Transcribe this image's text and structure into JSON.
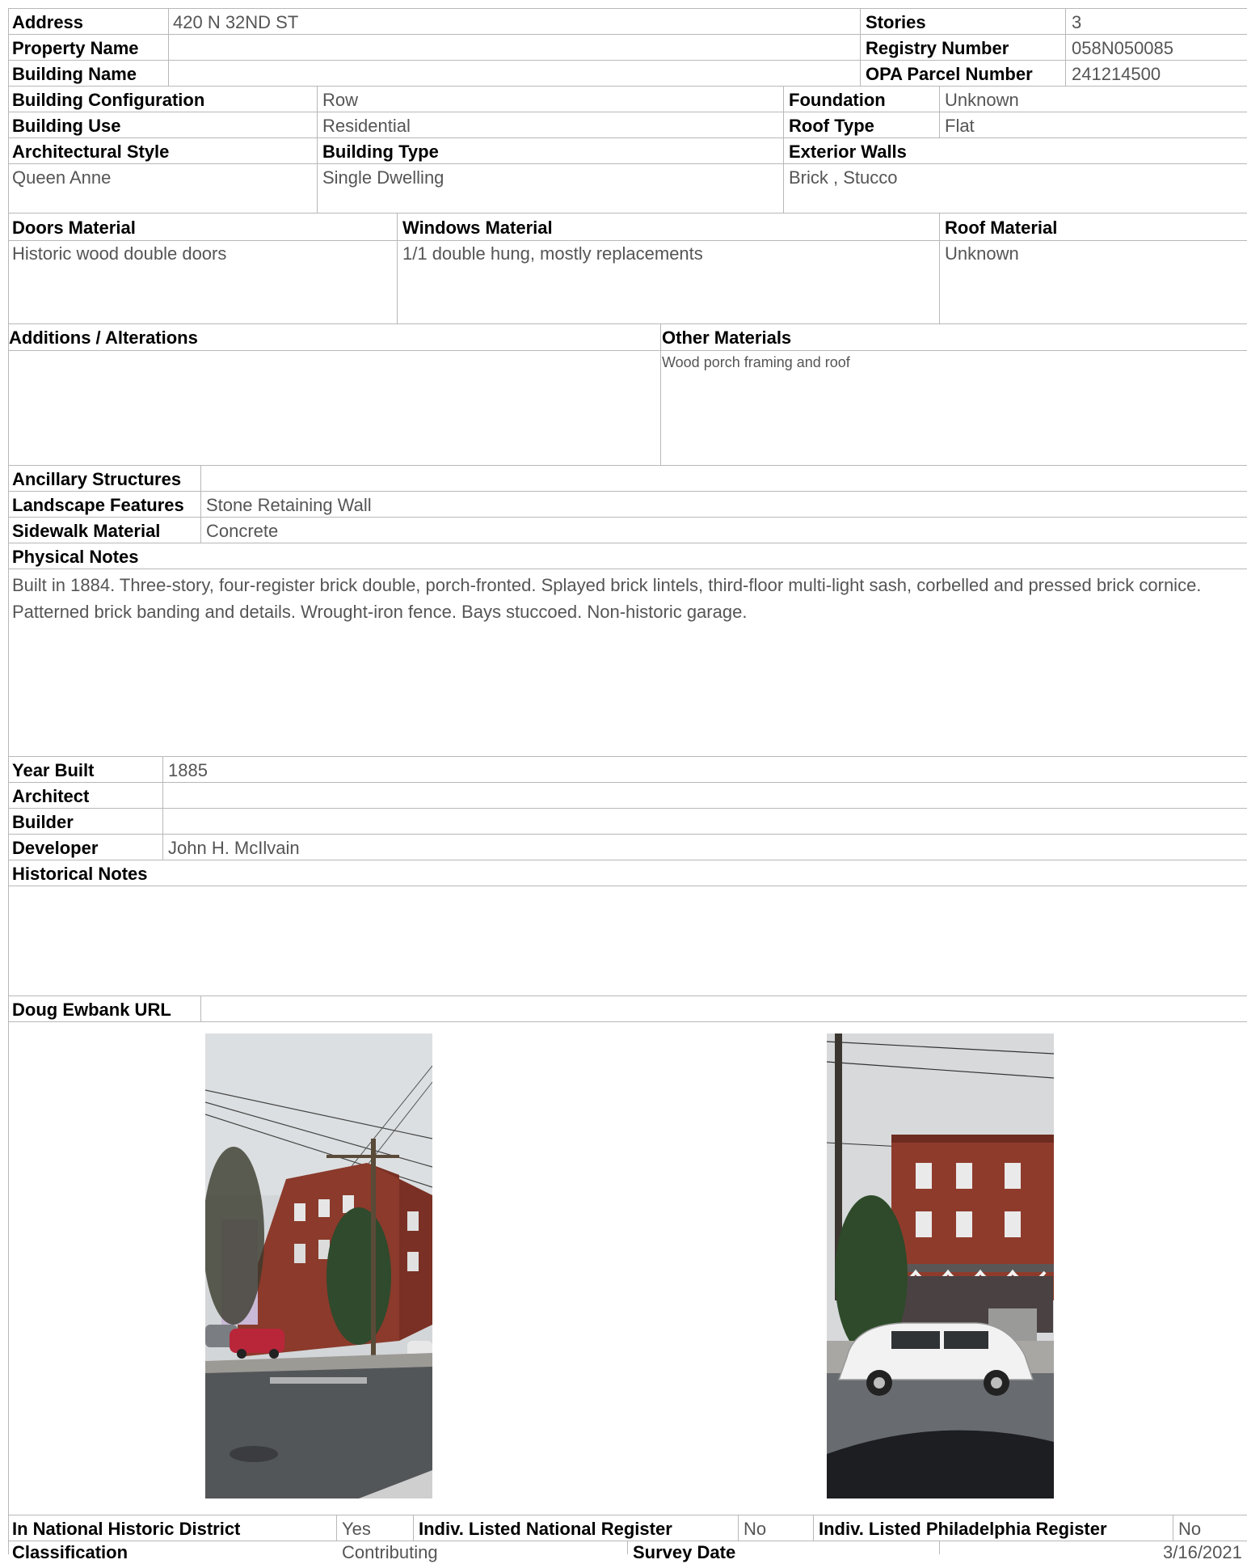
{
  "rows": {
    "address_label": "Address",
    "address": "420 N 32ND ST",
    "stories_label": "Stories",
    "stories": "3",
    "property_name_label": "Property Name",
    "property_name": "",
    "registry_label": "Registry Number",
    "registry": "058N050085",
    "building_name_label": "Building Name",
    "building_name": "",
    "opa_label": "OPA Parcel Number",
    "opa": "241214500",
    "config_label": "Building Configuration",
    "config": "Row",
    "foundation_label": "Foundation",
    "foundation": "Unknown",
    "use_label": "Building Use",
    "use": "Residential",
    "roof_type_label": "Roof Type",
    "roof_type": "Flat",
    "arch_style_label": "Architectural Style",
    "arch_style": "Queen Anne",
    "building_type_label": "Building Type",
    "building_type": "Single Dwelling",
    "ext_walls_label": "Exterior Walls",
    "ext_walls": "Brick , Stucco",
    "doors_label": "Doors Material",
    "doors": "Historic wood double doors",
    "windows_label": "Windows Material",
    "windows": "1/1 double hung, mostly replacements",
    "roof_mat_label": "Roof Material",
    "roof_mat": "Unknown",
    "additions_label": "Additions / Alterations",
    "additions": "",
    "other_mat_label": "Other Materials",
    "other_mat": "Wood porch framing and roof",
    "ancillary_label": "Ancillary Structures",
    "ancillary": "",
    "landscape_label": "Landscape Features",
    "landscape": "Stone Retaining Wall",
    "sidewalk_label": "Sidewalk Material",
    "sidewalk": "Concrete",
    "physical_label": "Physical Notes",
    "physical": "Built in 1884. Three-story, four-register brick double, porch-fronted. Splayed brick lintels, third-floor multi-light sash, corbelled and pressed brick cornice. Patterned brick banding and details. Wrought-iron fence. Bays stuccoed. Non-historic garage.",
    "year_label": "Year Built",
    "year": "1885",
    "architect_label": "Architect",
    "architect": "",
    "builder_label": "Builder",
    "builder": "",
    "developer_label": "Developer",
    "developer": "John H. McIlvain",
    "historical_label": "Historical Notes",
    "historical": "",
    "ewbank_label": "Doug Ewbank URL",
    "ewbank": "",
    "nhd_label": "In National Historic District",
    "nhd": "Yes",
    "inr_label": "Indiv. Listed National Register",
    "inr": "No",
    "ipr_label": "Indiv. Listed Philadelphia Register",
    "ipr": "No",
    "class_label": "Classification",
    "class": "Contributing",
    "survey_label": "Survey Date",
    "survey": "3/16/2021"
  },
  "photos": [
    {
      "subject": "corner-view-photo"
    },
    {
      "subject": "front-view-photo"
    }
  ]
}
